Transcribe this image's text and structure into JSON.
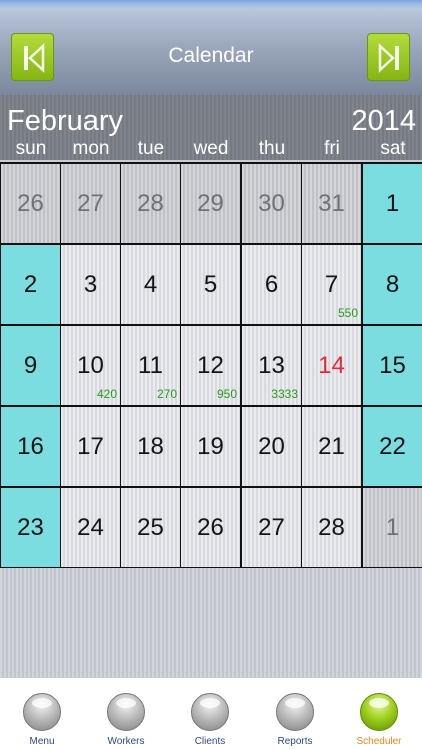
{
  "header": {
    "title": "Calendar"
  },
  "month": "February",
  "year": "2014",
  "days_of_week": [
    "sun",
    "mon",
    "tue",
    "wed",
    "thu",
    "fri",
    "sat"
  ],
  "weeks": [
    [
      {
        "day": "26",
        "type": "other"
      },
      {
        "day": "27",
        "type": "other"
      },
      {
        "day": "28",
        "type": "other"
      },
      {
        "day": "29",
        "type": "other"
      },
      {
        "day": "30",
        "type": "other"
      },
      {
        "day": "31",
        "type": "other"
      },
      {
        "day": "1",
        "type": "weekend"
      }
    ],
    [
      {
        "day": "2",
        "type": "weekend"
      },
      {
        "day": "3"
      },
      {
        "day": "4"
      },
      {
        "day": "5"
      },
      {
        "day": "6"
      },
      {
        "day": "7",
        "amount": "550"
      },
      {
        "day": "8",
        "type": "weekend"
      }
    ],
    [
      {
        "day": "9",
        "type": "weekend"
      },
      {
        "day": "10",
        "amount": "420"
      },
      {
        "day": "11",
        "amount": "270"
      },
      {
        "day": "12",
        "amount": "950"
      },
      {
        "day": "13",
        "amount": "3333"
      },
      {
        "day": "14",
        "type": "today"
      },
      {
        "day": "15",
        "type": "weekend"
      }
    ],
    [
      {
        "day": "16",
        "type": "weekend"
      },
      {
        "day": "17"
      },
      {
        "day": "18"
      },
      {
        "day": "19"
      },
      {
        "day": "20"
      },
      {
        "day": "21"
      },
      {
        "day": "22",
        "type": "weekend"
      }
    ],
    [
      {
        "day": "23",
        "type": "weekend"
      },
      {
        "day": "24"
      },
      {
        "day": "25"
      },
      {
        "day": "26"
      },
      {
        "day": "27"
      },
      {
        "day": "28"
      },
      {
        "day": "1",
        "type": "other"
      }
    ]
  ],
  "tabs": [
    {
      "label": "Menu",
      "active": false
    },
    {
      "label": "Workers",
      "active": false
    },
    {
      "label": "Clients",
      "active": false
    },
    {
      "label": "Reports",
      "active": false
    },
    {
      "label": "Scheduler",
      "active": true
    }
  ],
  "colors": {
    "accent": "#9fd11e",
    "weekend": "#7bdddf",
    "today": "#e8283a",
    "amount": "#2a9a1e"
  }
}
